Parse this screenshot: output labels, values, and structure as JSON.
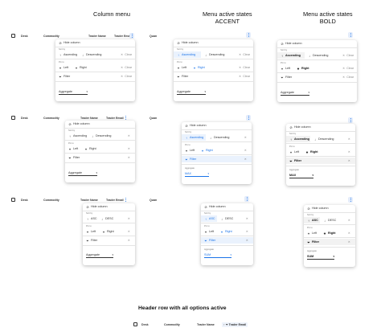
{
  "titles": {
    "column_menu": "Column menu",
    "active_states": "Menu active states",
    "accent": "ACCENT",
    "bold": "BOLD",
    "header_row": "Header row with all options active"
  },
  "columns": [
    "Desk",
    "Commodity",
    "Trader Name",
    "Trader Email",
    "Quan"
  ],
  "menu": {
    "hide_column": "Hide column",
    "sort_by": "Sort by",
    "pin_to": "Pin to",
    "ascending": "Ascending",
    "descending": "Descending",
    "asc": "ASC",
    "desc": "DESC",
    "left": "Left",
    "right": "Right",
    "filter": "Filter",
    "clear": "Clear",
    "aggregate": "Aggregate",
    "agg_max": "MAX",
    "agg_sum": "SUM"
  },
  "icons": {
    "hide": "eye-off-icon",
    "ascending": "sort-up-icon",
    "descending": "sort-down-icon",
    "pin-left": "pin-icon",
    "pin-right": "pin-icon",
    "filter": "funnel-icon",
    "clear": "close-icon",
    "kebab": "more-vertical-icon",
    "dropdown": "chevron-down-icon"
  },
  "colors": {
    "accent": "#1a73e8",
    "accent_bg": "#eaf2fd"
  }
}
